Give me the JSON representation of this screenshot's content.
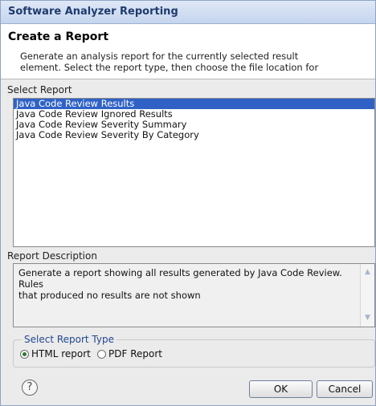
{
  "window": {
    "title": "Software Analyzer Reporting"
  },
  "header": {
    "title": "Create a Report",
    "description_line1": "Generate an analysis report for the currently selected result",
    "description_line2": "element. Select the report type, then choose the file location for"
  },
  "select_report": {
    "label": "Select Report",
    "items": [
      "Java Code Review Results",
      "Java Code Review Ignored Results",
      "Java Code Review Severity Summary",
      "Java Code Review Severity By Category"
    ],
    "selected_index": 0
  },
  "report_description": {
    "label": "Report Description",
    "text_line1": "Generate a report showing all results generated by Java Code Review.  Rules",
    "text_line2": "that produced no results are not shown"
  },
  "report_type": {
    "label": "Select Report Type",
    "options": [
      "HTML report",
      "PDF Report"
    ],
    "selected": "HTML report"
  },
  "buttons": {
    "ok": "OK",
    "cancel": "Cancel",
    "help_icon": "question-mark-icon"
  },
  "colors": {
    "accent": "#3062c6",
    "title_text": "#1f3b6e",
    "group_label": "#23478f"
  }
}
